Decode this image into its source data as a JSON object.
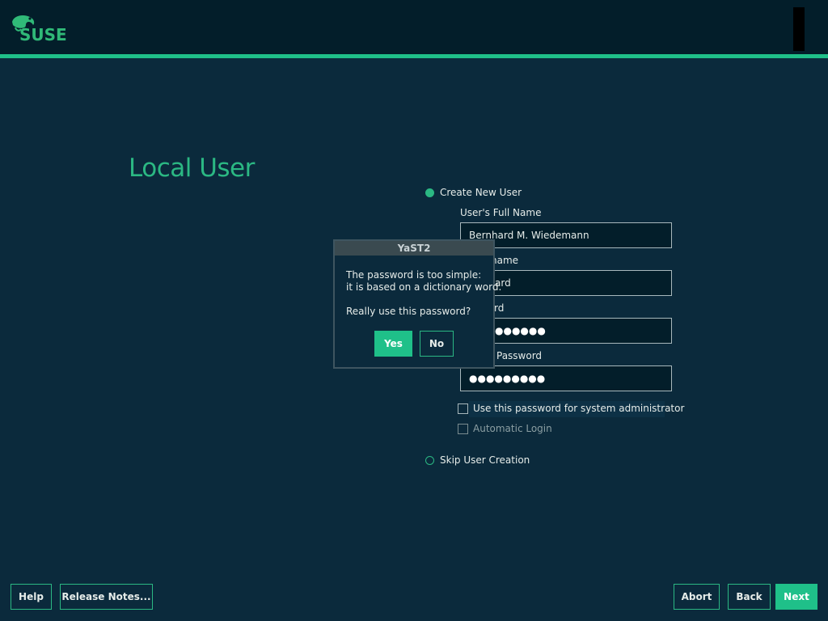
{
  "brand": {
    "name": "SUSE",
    "accent": "#2bb883",
    "bar_color": "#1fc089"
  },
  "page": {
    "title": "Local User"
  },
  "form": {
    "create_user": {
      "label": "Create New User",
      "mnemonic": "C",
      "selected": true
    },
    "full_name": {
      "label": "User's Full Name",
      "value": "Bernhard M. Wiedemann"
    },
    "username": {
      "label": "Username",
      "value": "bernhard",
      "visible_label": "name",
      "visible_value": "ard"
    },
    "password": {
      "label": "Password",
      "visible_label": "rd",
      "value_masked": "●●●●●●"
    },
    "confirm_password": {
      "label": "Confirm Password",
      "visible_label": "Password",
      "value_masked": "●●●●●●●●●"
    },
    "use_for_admin": {
      "label": "Use this password for system administrator",
      "checked": false
    },
    "auto_login": {
      "label": "Automatic Login",
      "checked": false,
      "enabled": false
    },
    "skip_user": {
      "label": "Skip User Creation",
      "selected": false
    }
  },
  "dialog": {
    "title": "YaST2",
    "line1": "The password is too simple:",
    "line2": "it is based on a dictionary word.",
    "line3": "Really use this password?",
    "yes_label": "Yes",
    "no_label": "No"
  },
  "buttons": {
    "help": "Help",
    "release_notes": "Release Notes...",
    "abort": "Abort",
    "back": "Back",
    "next": "Next"
  },
  "icons": {
    "logo": "suse-chameleon-icon"
  }
}
